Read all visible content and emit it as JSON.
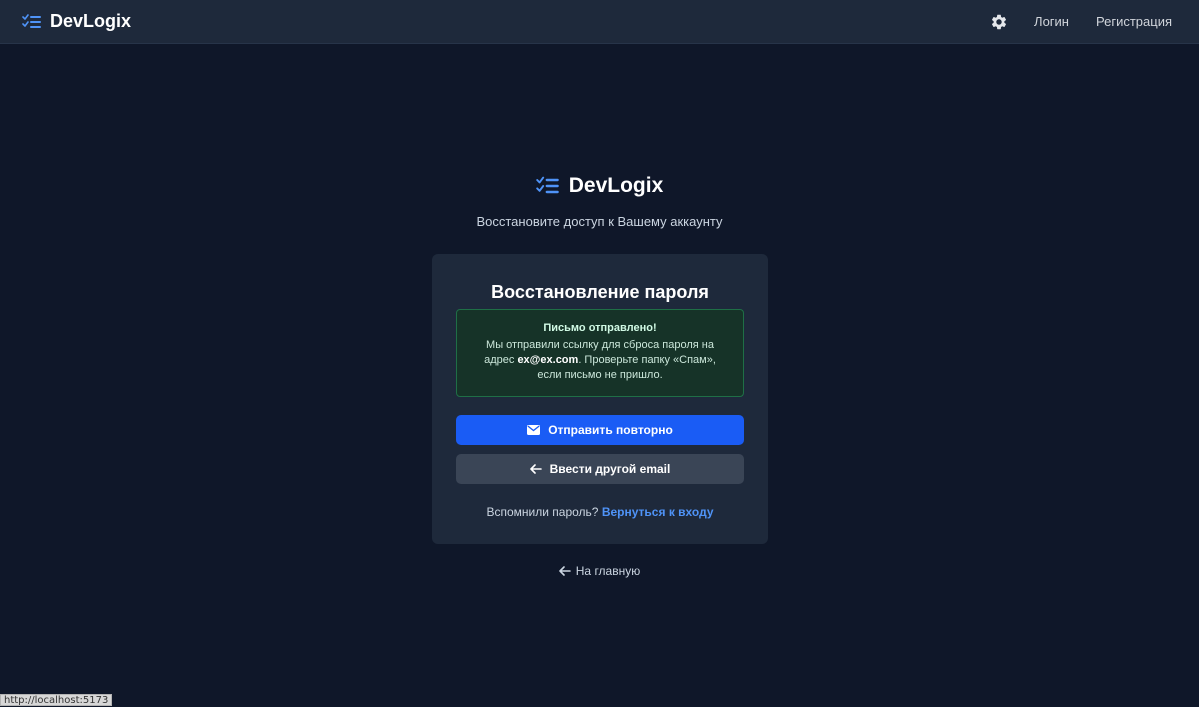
{
  "navbar": {
    "brand": "DevLogix",
    "login_label": "Логин",
    "register_label": "Регистрация"
  },
  "header": {
    "brand": "DevLogix",
    "subtitle": "Восстановите доступ к Вашему аккаунту"
  },
  "card": {
    "title": "Восстановление пароля",
    "alert": {
      "title": "Письмо отправлено!",
      "text_before": "Мы отправили ссылку для сброса пароля на адрес ",
      "email": "ex@ex.com",
      "text_after": ". Проверьте папку «Спам», если письмо не пришло."
    },
    "resend_label": "Отправить повторно",
    "other_email_label": "Ввести другой email",
    "remember_text": "Вспомнили пароль?",
    "back_to_login_label": "Вернуться к входу"
  },
  "home_link_label": "На главную",
  "status_bar_url": "http://localhost:5173",
  "colors": {
    "background": "#0f1729",
    "panel": "#1e293b",
    "accent": "#1a5cf5",
    "link": "#4f93f7",
    "success_bg": "#163328",
    "success_border": "#1f6f46"
  },
  "icons": {
    "brand": "checklist-icon",
    "settings": "gear-icon",
    "resend": "envelope-icon",
    "back": "arrow-left-icon"
  }
}
